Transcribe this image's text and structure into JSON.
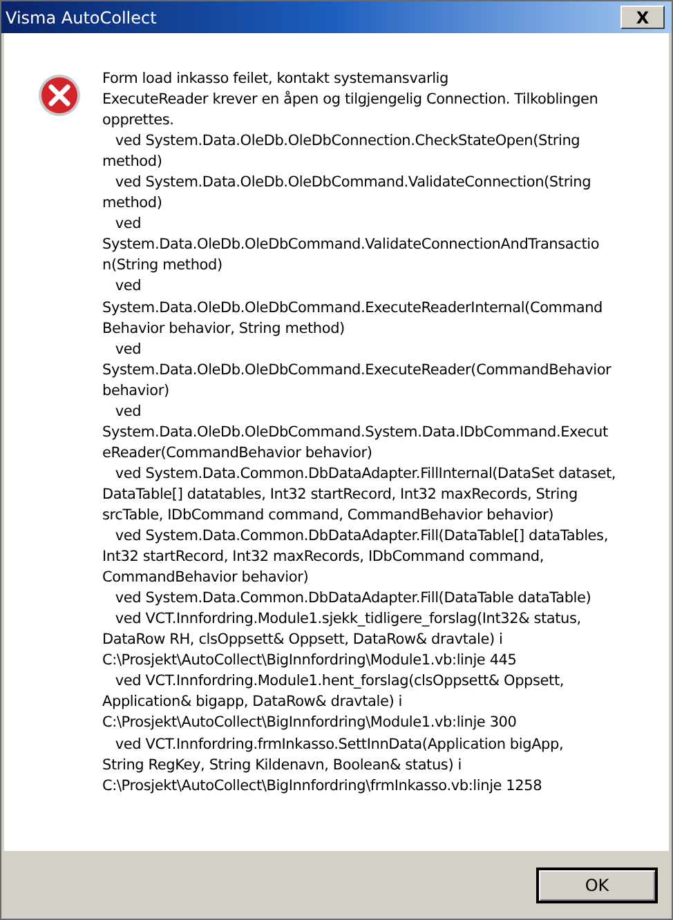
{
  "window": {
    "title": "Visma AutoCollect",
    "close": "X"
  },
  "message_lines": [
    "Form load inkasso feilet, kontakt systemansvarlig",
    "ExecuteReader krever en åpen og tilgjengelig Connection. Tilkoblingen",
    "opprettes.",
    "   ved System.Data.OleDb.OleDbConnection.CheckStateOpen(String",
    "method)",
    "   ved System.Data.OleDb.OleDbCommand.ValidateConnection(String",
    "method)",
    "   ved",
    "System.Data.OleDb.OleDbCommand.ValidateConnectionAndTransactio",
    "n(String method)",
    "   ved",
    "System.Data.OleDb.OleDbCommand.ExecuteReaderInternal(Command",
    "Behavior behavior, String method)",
    "   ved",
    "System.Data.OleDb.OleDbCommand.ExecuteReader(CommandBehavior",
    "behavior)",
    "   ved",
    "System.Data.OleDb.OleDbCommand.System.Data.IDbCommand.Execut",
    "eReader(CommandBehavior behavior)",
    "   ved System.Data.Common.DbDataAdapter.FillInternal(DataSet dataset,",
    "DataTable[] datatables, Int32 startRecord, Int32 maxRecords, String",
    "srcTable, IDbCommand command, CommandBehavior behavior)",
    "   ved System.Data.Common.DbDataAdapter.Fill(DataTable[] dataTables,",
    "Int32 startRecord, Int32 maxRecords, IDbCommand command,",
    "CommandBehavior behavior)",
    "   ved System.Data.Common.DbDataAdapter.Fill(DataTable dataTable)",
    "   ved VCT.Innfordring.Module1.sjekk_tidligere_forslag(Int32& status,",
    "DataRow RH, clsOppsett& Oppsett, DataRow& dravtale) i",
    "C:\\Prosjekt\\AutoCollect\\BigInnfordring\\Module1.vb:linje 445",
    "   ved VCT.Innfordring.Module1.hent_forslag(clsOppsett& Oppsett,",
    "Application& bigapp, DataRow& dravtale) i",
    "C:\\Prosjekt\\AutoCollect\\BigInnfordring\\Module1.vb:linje 300",
    "   ved VCT.Innfordring.frmInkasso.SettInnData(Application bigApp,",
    "String RegKey, String Kildenavn, Boolean& status) i",
    "C:\\Prosjekt\\AutoCollect\\BigInnfordring\\frmInkasso.vb:linje 1258"
  ],
  "buttons": [
    "OK"
  ]
}
